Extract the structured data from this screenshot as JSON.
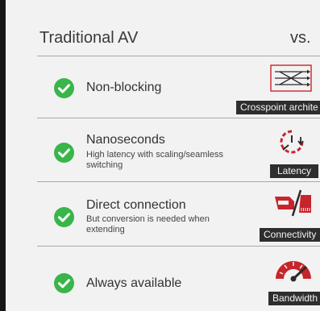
{
  "header": {
    "left": "Traditional AV",
    "right": "vs."
  },
  "rows": [
    {
      "title": "Non-blocking",
      "subtitle": "",
      "icon": "crosspoint-switch-icon",
      "caption": "Crosspoint archite"
    },
    {
      "title": "Nanoseconds",
      "subtitle": "High latency with scaling/seamless switching",
      "icon": "stopwatch-icon",
      "caption": "Latency"
    },
    {
      "title": "Direct connection",
      "subtitle": "But conversion is needed when extending",
      "icon": "cable-connector-icon",
      "caption": "Connectivity"
    },
    {
      "title": "Always available",
      "subtitle": "",
      "icon": "speedometer-icon",
      "caption": "Bandwidth"
    }
  ],
  "colors": {
    "check": "#39b54a",
    "icon_red": "#c8242b",
    "caption_bg": "#2e2e2e"
  }
}
